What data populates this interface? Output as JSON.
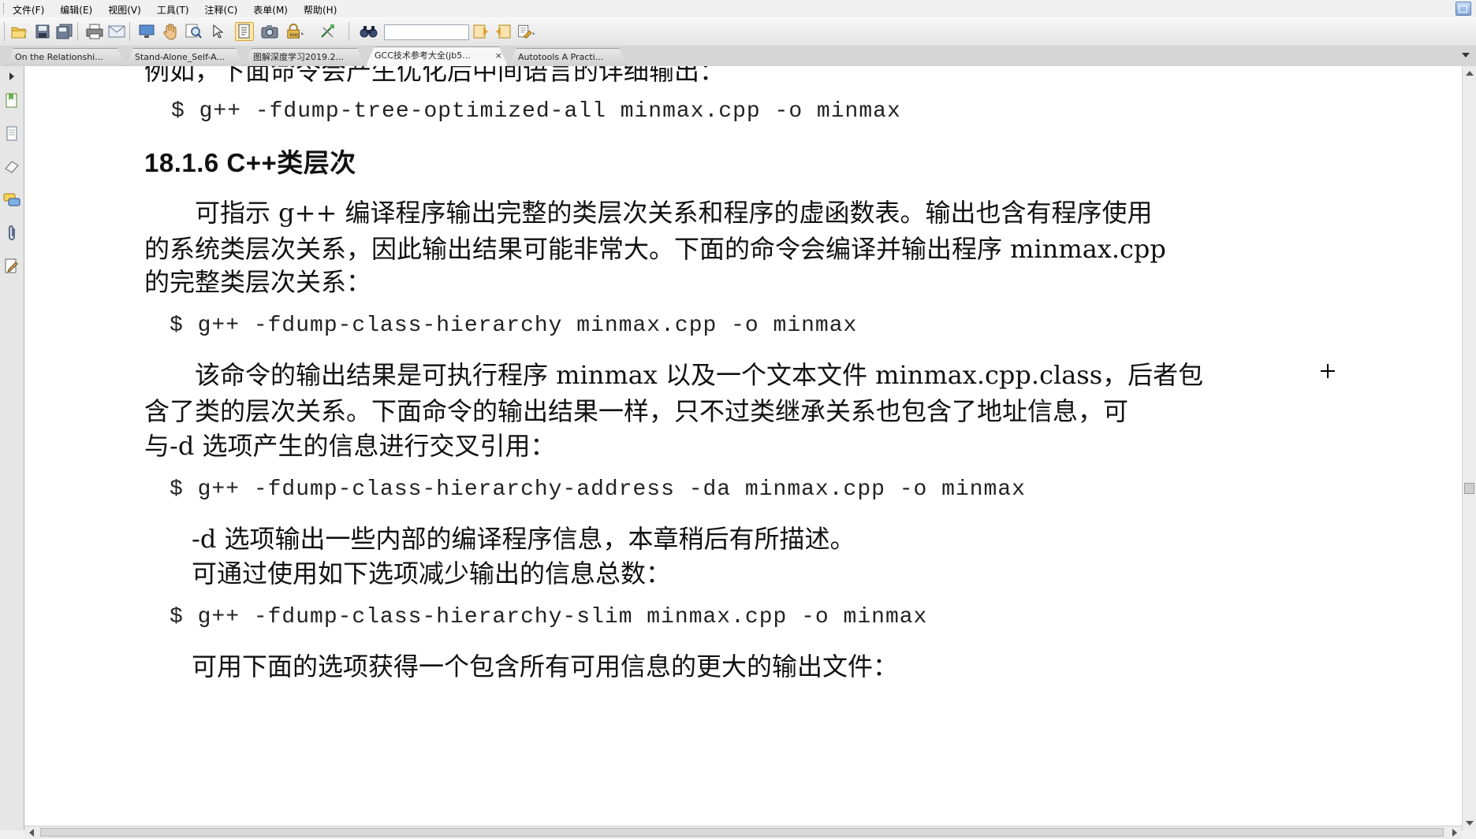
{
  "menubar": {
    "items": [
      "文件(F)",
      "编辑(E)",
      "视图(V)",
      "工具(T)",
      "注释(C)",
      "表单(M)",
      "帮助(H)"
    ]
  },
  "toolbar": {
    "icons": [
      "open-icon",
      "save-icon",
      "save-all-icon",
      "print-icon",
      "email-icon",
      "screen-icon",
      "hand-tool-icon",
      "zoom-icon",
      "select-arrow-icon",
      "text-select-icon",
      "snapshot-icon",
      "lock-icon",
      "typewriter-icon",
      "find-icon",
      "prev-result-icon",
      "next-result-icon",
      "highlight-icon"
    ],
    "search_value": ""
  },
  "tabs": [
    {
      "label": "On the Relationshi..."
    },
    {
      "label": "Stand-Alone_Self-A..."
    },
    {
      "label": "图解深度学习2019.2..."
    },
    {
      "label": "GCC技术参考大全(jb5...",
      "active": true
    },
    {
      "label": "Autotools A Practi..."
    }
  ],
  "tab_close": "×",
  "document": {
    "p0": "例如，下面命令会产生优化后中间语言的详细输出：",
    "code1": "$ g++ -fdump-tree-optimized-all minmax.cpp -o minmax",
    "heading": "18.1.6   C++类层次",
    "p1_l1": "可指示 g++ 编译程序输出完整的类层次关系和程序的虚函数表。输出也含有程序使用",
    "p1_l2": "的系统类层次关系，因此输出结果可能非常大。下面的命令会编译并输出程序 minmax.cpp",
    "p1_l3": "的完整类层次关系：",
    "code2": "$ g++ -fdump-class-hierarchy minmax.cpp -o minmax",
    "p2_l1": "该命令的输出结果是可执行程序 minmax 以及一个文本文件 minmax.cpp.class，后者包",
    "p2_l2": "含了类的层次关系。下面命令的输出结果一样，只不过类继承关系也包含了地址信息，可",
    "p2_l3": "与-d 选项产生的信息进行交叉引用：",
    "code3": "$ g++ -fdump-class-hierarchy-address -da minmax.cpp -o minmax",
    "p3": "-d 选项输出一些内部的编译程序信息，本章稍后有所描述。",
    "p4": "可通过使用如下选项减少输出的信息总数：",
    "code4": "$ g++ -fdump-class-hierarchy-slim minmax.cpp -o minmax",
    "p5": "可用下面的选项获得一个包含所有可用信息的更大的输出文件："
  }
}
